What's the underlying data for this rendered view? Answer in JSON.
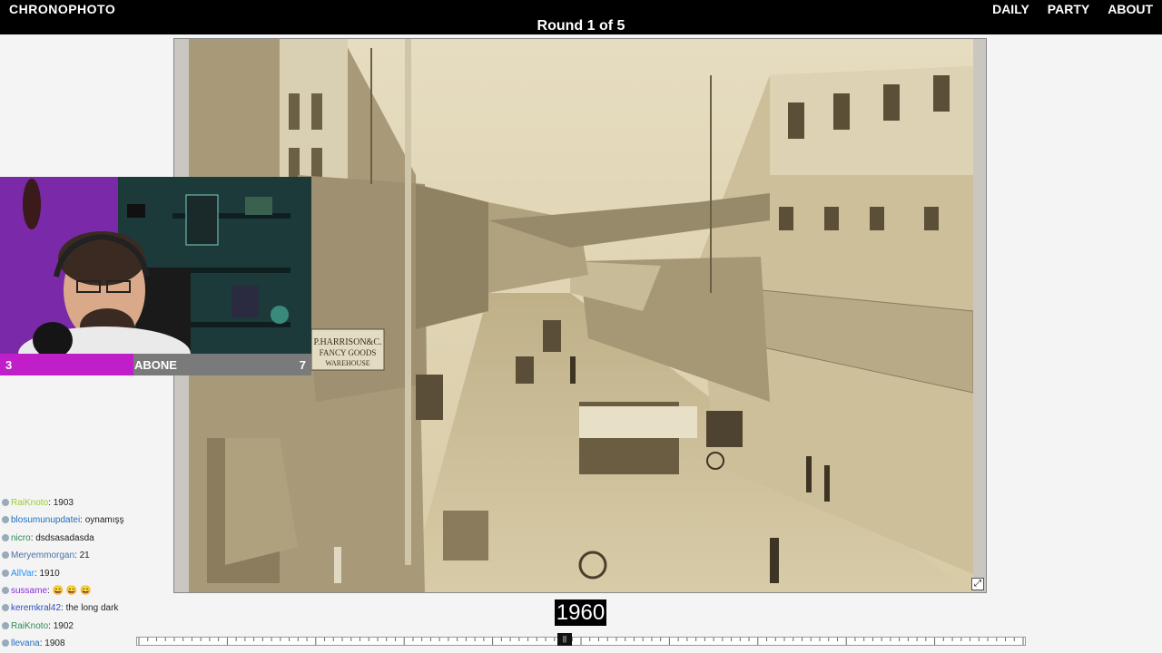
{
  "app": {
    "logo": "CHRONOPHOTO"
  },
  "nav": {
    "daily": "DAILY",
    "party": "PARTY",
    "about": "ABOUT"
  },
  "round": {
    "label": "Round 1 of 5"
  },
  "guess": {
    "year": "1960"
  },
  "photo": {
    "signs": {
      "line1": "P.HARRISON&C.",
      "line2": "FANCY GOODS",
      "line3": "WAREHOUSE"
    }
  },
  "abone": {
    "current": "3",
    "label": "ABONE",
    "goal": "7",
    "progress": 0.43
  },
  "chat": [
    {
      "user": "RaiKnoto",
      "text": ": 1903",
      "color": "#9acd32"
    },
    {
      "user": "blosumunupdatei",
      "text": ": oynamışş",
      "color": "#1e6ebf"
    },
    {
      "user": "nicro",
      "text": ": dsdsasadasda",
      "color": "#2e8b57"
    },
    {
      "user": "Meryemmorgan",
      "text": ": 21",
      "color": "#4a6fa5"
    },
    {
      "user": "AllVar",
      "text": ": 1910",
      "color": "#1e90ff"
    },
    {
      "user": "sussame",
      "text": ": 😄 😄 😄",
      "color": "#8a2be2"
    },
    {
      "user": "keremkral42",
      "text": ": the long dark",
      "color": "#3050c0"
    },
    {
      "user": "RaiKnoto",
      "text": ": 1902",
      "color": "#2e8b57"
    },
    {
      "user": "llevana",
      "text": ": 1908",
      "color": "#1e6ebf"
    }
  ],
  "timeline": {
    "handle_glyph": "||"
  },
  "icons": {
    "expand": "expand-icon"
  }
}
